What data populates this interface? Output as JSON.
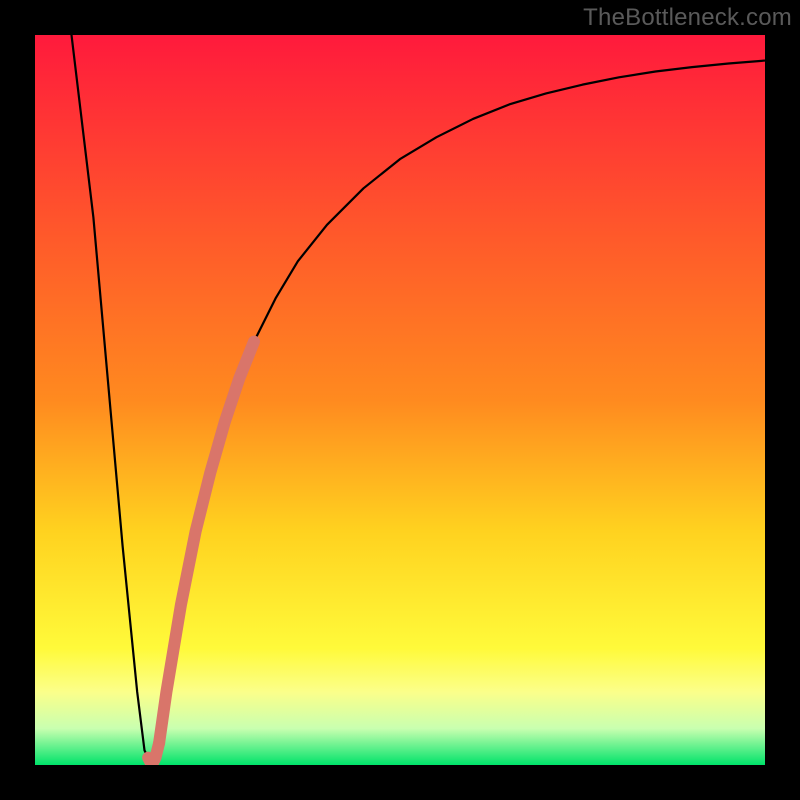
{
  "attribution": "TheBottleneck.com",
  "colors": {
    "bg": "#000000",
    "gradient_top": "#ff1a3c",
    "gradient_mid_upper": "#ff8a1f",
    "gradient_mid": "#ffd21f",
    "gradient_lower": "#fffa3a",
    "gradient_band": "#fbff8a",
    "gradient_bottom": "#00e36a",
    "curve": "#000000",
    "highlight": "#d9756a"
  },
  "chart_data": {
    "type": "line",
    "title": "",
    "xlabel": "",
    "ylabel": "",
    "xlim": [
      0,
      100
    ],
    "ylim": [
      0,
      100
    ],
    "series": [
      {
        "name": "bottleneck-curve",
        "x": [
          5,
          8,
          12,
          14,
          15,
          16,
          17,
          18,
          20,
          22,
          24,
          26,
          28,
          30,
          33,
          36,
          40,
          45,
          50,
          55,
          60,
          65,
          70,
          75,
          80,
          85,
          90,
          95,
          100
        ],
        "y": [
          100,
          75,
          30,
          10,
          2,
          0,
          3,
          10,
          22,
          32,
          40,
          47,
          53,
          58,
          64,
          69,
          74,
          79,
          83,
          86,
          88.5,
          90.5,
          92,
          93.2,
          94.2,
          95,
          95.6,
          96.1,
          96.5
        ]
      },
      {
        "name": "highlight-segment",
        "x": [
          17,
          18,
          20,
          22,
          24,
          26,
          28,
          30
        ],
        "y": [
          3,
          10,
          22,
          32,
          40,
          47,
          53,
          58
        ]
      },
      {
        "name": "highlight-hook",
        "x": [
          15.5,
          16,
          16.5,
          17
        ],
        "y": [
          1,
          0,
          1,
          3
        ]
      }
    ],
    "annotations": []
  }
}
